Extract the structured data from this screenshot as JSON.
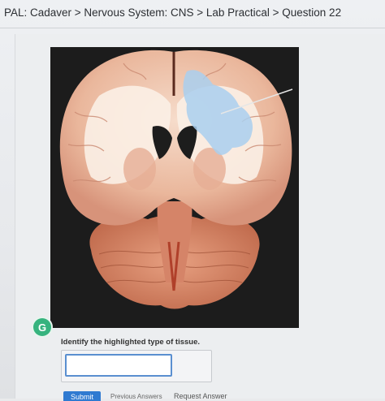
{
  "header": {
    "breadcrumb": "PAL: Cadaver > Nervous System: CNS > Lab Practical > Question 22"
  },
  "specimen": {
    "highlight_color": "#a9cfee"
  },
  "status_badge": "G",
  "question": {
    "prompt": "Identify the highlighted type of tissue.",
    "answer_value": "",
    "answer_placeholder": ""
  },
  "actions": {
    "submit_label": "Submit",
    "previous_label": "Previous Answers",
    "request_label": "Request Answer"
  }
}
